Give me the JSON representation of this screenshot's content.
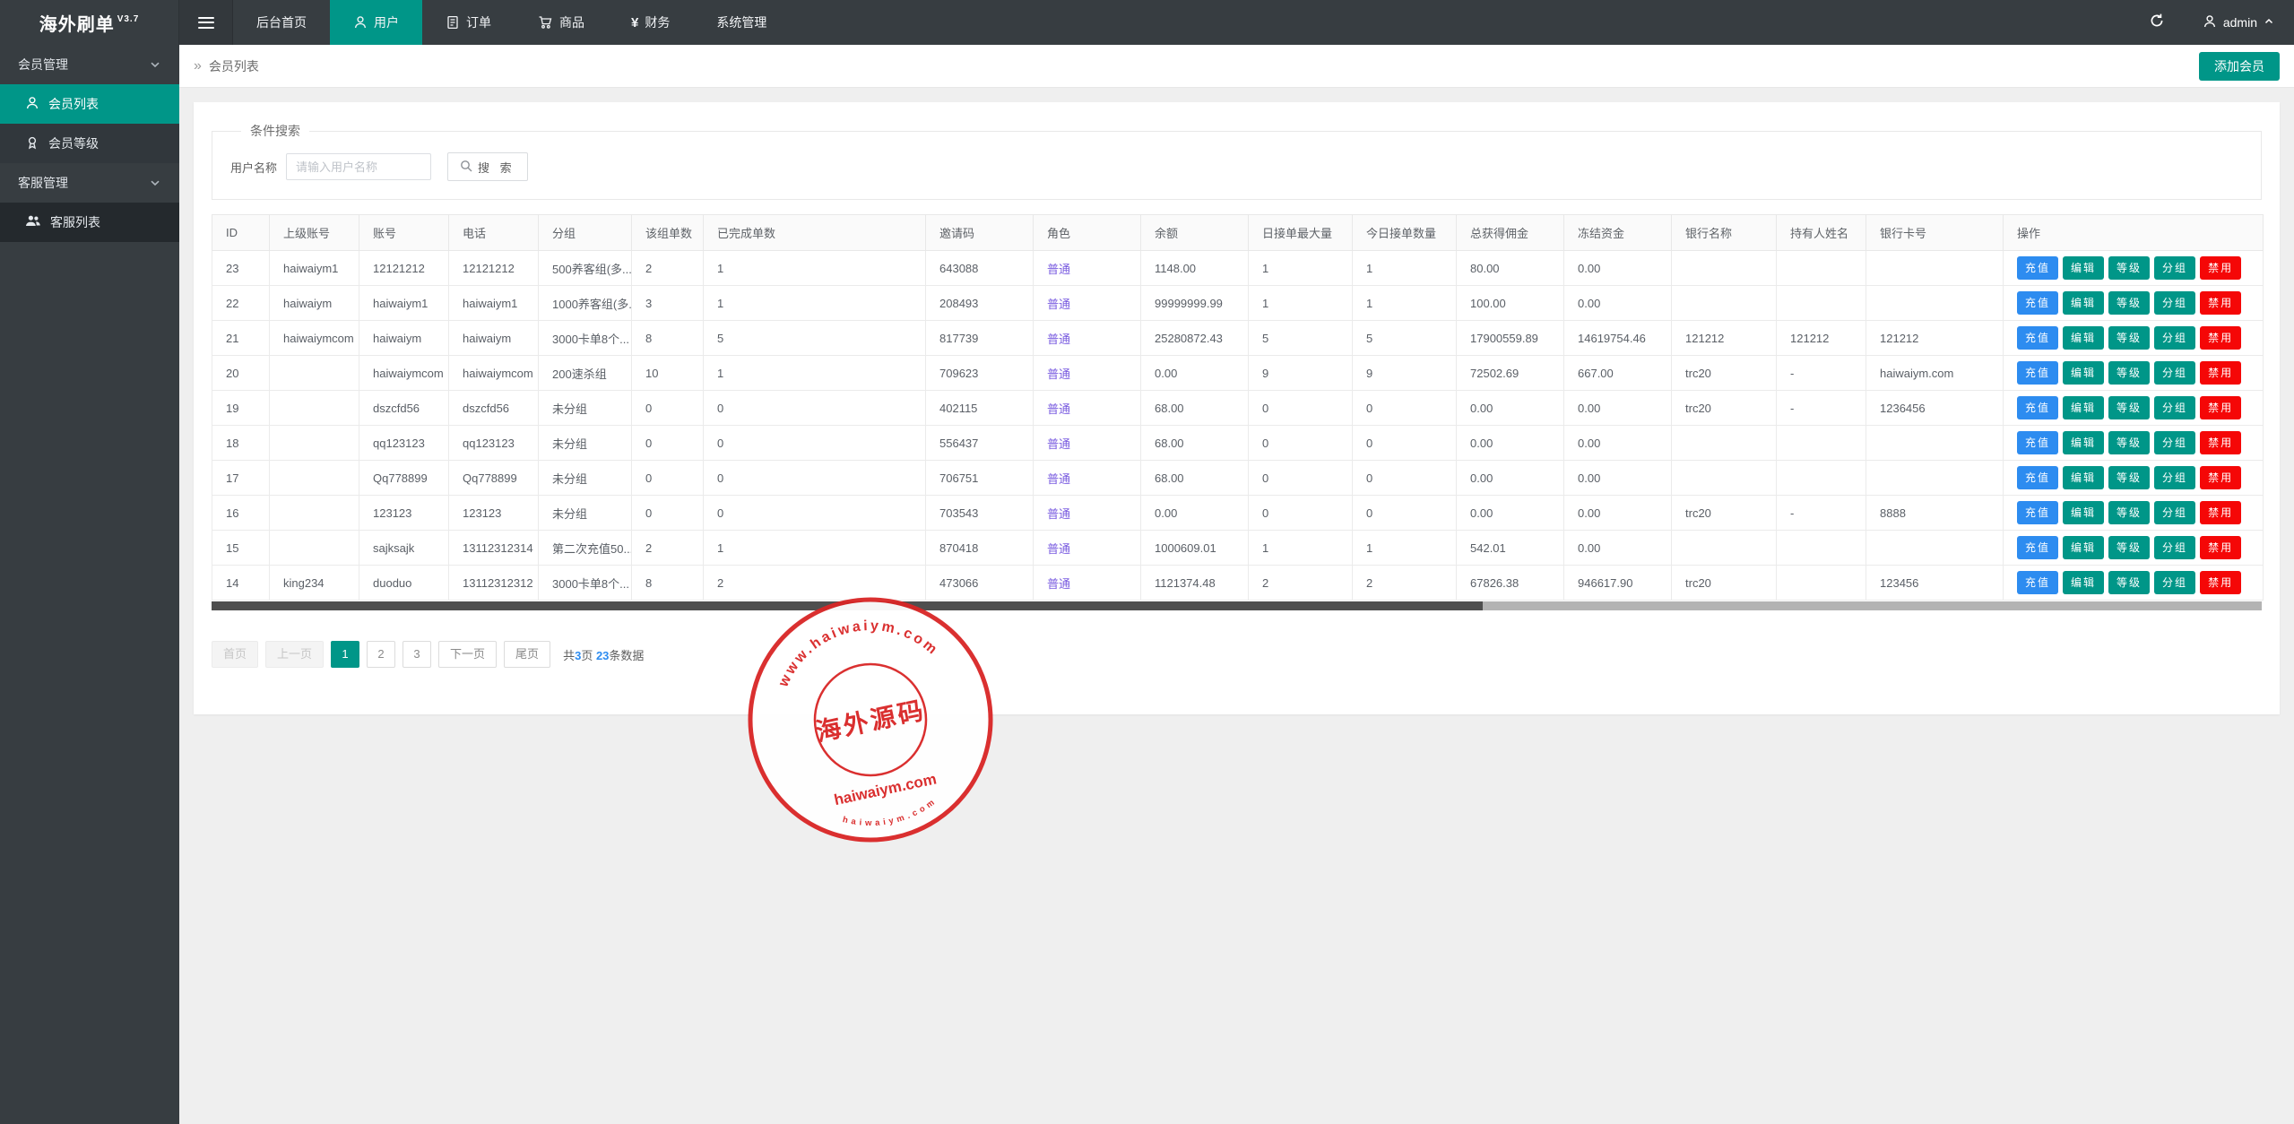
{
  "app": {
    "title": "海外刷单",
    "version": "V3.7"
  },
  "topnav": {
    "items": [
      {
        "label": "后台首页",
        "icon": null,
        "active": false
      },
      {
        "label": "用户",
        "icon": "user-icon",
        "active": true
      },
      {
        "label": "订单",
        "icon": "document-icon",
        "active": false
      },
      {
        "label": "商品",
        "icon": "cart-icon",
        "active": false
      },
      {
        "label": "财务",
        "icon": "yen-icon",
        "active": false
      },
      {
        "label": "系统管理",
        "icon": null,
        "active": false
      }
    ],
    "user": {
      "name": "admin"
    }
  },
  "sidebar": {
    "groups": [
      {
        "label": "会员管理",
        "items": [
          {
            "label": "会员列表",
            "icon": "user-icon",
            "active": true
          },
          {
            "label": "会员等级",
            "icon": "medal-icon",
            "active": false
          }
        ]
      },
      {
        "label": "客服管理",
        "items": [
          {
            "label": "客服列表",
            "icon": "users-icon",
            "active": false
          }
        ]
      }
    ]
  },
  "breadcrumb": {
    "title": "会员列表",
    "add_button": "添加会员"
  },
  "search": {
    "legend": "条件搜索",
    "label": "用户名称",
    "placeholder": "请输入用户名称",
    "button": "搜 索"
  },
  "table": {
    "columns": [
      "ID",
      "上级账号",
      "账号",
      "电话",
      "分组",
      "该组单数",
      "已完成单数",
      "邀请码",
      "角色",
      "余额",
      "日接单最大量",
      "今日接单数量",
      "总获得佣金",
      "冻结资金",
      "银行名称",
      "持有人姓名",
      "银行卡号",
      "操作"
    ],
    "role_value": "普通",
    "rows": [
      {
        "cells": [
          "23",
          "haiwaiym1",
          "12121212",
          "12121212",
          "500养客组(多...",
          "2",
          "1",
          "643088",
          "普通",
          "1148.00",
          "1",
          "1",
          "80.00",
          "0.00",
          "",
          "",
          ""
        ]
      },
      {
        "cells": [
          "22",
          "haiwaiym",
          "haiwaiym1",
          "haiwaiym1",
          "1000养客组(多...",
          "3",
          "1",
          "208493",
          "普通",
          "99999999.99",
          "1",
          "1",
          "100.00",
          "0.00",
          "",
          "",
          ""
        ]
      },
      {
        "cells": [
          "21",
          "haiwaiymcom",
          "haiwaiym",
          "haiwaiym",
          "3000卡单8个...",
          "8",
          "5",
          "817739",
          "普通",
          "25280872.43",
          "5",
          "5",
          "17900559.89",
          "14619754.46",
          "121212",
          "121212",
          "121212"
        ]
      },
      {
        "cells": [
          "20",
          "",
          "haiwaiymcom",
          "haiwaiymcom",
          "200速杀组",
          "10",
          "1",
          "709623",
          "普通",
          "0.00",
          "9",
          "9",
          "72502.69",
          "667.00",
          "trc20",
          "-",
          "haiwaiym.com"
        ]
      },
      {
        "cells": [
          "19",
          "",
          "dszcfd56",
          "dszcfd56",
          "未分组",
          "0",
          "0",
          "402115",
          "普通",
          "68.00",
          "0",
          "0",
          "0.00",
          "0.00",
          "trc20",
          "-",
          "1236456"
        ]
      },
      {
        "cells": [
          "18",
          "",
          "qq123123",
          "qq123123",
          "未分组",
          "0",
          "0",
          "556437",
          "普通",
          "68.00",
          "0",
          "0",
          "0.00",
          "0.00",
          "",
          "",
          ""
        ]
      },
      {
        "cells": [
          "17",
          "",
          "Qq778899",
          "Qq778899",
          "未分组",
          "0",
          "0",
          "706751",
          "普通",
          "68.00",
          "0",
          "0",
          "0.00",
          "0.00",
          "",
          "",
          ""
        ]
      },
      {
        "cells": [
          "16",
          "",
          "123123",
          "123123",
          "未分组",
          "0",
          "0",
          "703543",
          "普通",
          "0.00",
          "0",
          "0",
          "0.00",
          "0.00",
          "trc20",
          "-",
          "8888"
        ]
      },
      {
        "cells": [
          "15",
          "",
          "sajksajk",
          "13112312314",
          "第二次充值50...",
          "2",
          "1",
          "870418",
          "普通",
          "1000609.01",
          "1",
          "1",
          "542.01",
          "0.00",
          "",
          "",
          ""
        ]
      },
      {
        "cells": [
          "14",
          "king234",
          "duoduo",
          "13112312312",
          "3000卡单8个...",
          "8",
          "2",
          "473066",
          "普通",
          "1121374.48",
          "2",
          "2",
          "67826.38",
          "946617.90",
          "trc20",
          "",
          "123456"
        ]
      }
    ],
    "action_buttons": [
      {
        "key": "recharge",
        "label": "充值",
        "type": "blue"
      },
      {
        "key": "edit",
        "label": "编辑",
        "type": "green"
      },
      {
        "key": "level",
        "label": "等级",
        "type": "green"
      },
      {
        "key": "group",
        "label": "分组",
        "type": "green"
      },
      {
        "key": "disable",
        "label": "禁用",
        "type": "red"
      }
    ]
  },
  "pagination": {
    "first": "首页",
    "prev": "上一页",
    "pages": [
      "1",
      "2",
      "3"
    ],
    "active_page": "1",
    "next": "下一页",
    "last": "尾页",
    "info": {
      "prefix": "共",
      "pages_count": "3",
      "middle": "页 ",
      "records_count": "23",
      "suffix": "条数据"
    }
  },
  "watermark": {
    "arc_top": "www.haiwaiym.com",
    "center_text": "海外源码",
    "line_text": "haiwaiym.com",
    "arc_bottom": "haiwaiym.com"
  },
  "colors": {
    "accent_teal": "#009688",
    "navbar_dark": "#373d41",
    "button_blue": "#2d8cf0",
    "button_red": "#f50707",
    "role_purple": "#7a5ce0",
    "stamp_red": "#d92525"
  }
}
